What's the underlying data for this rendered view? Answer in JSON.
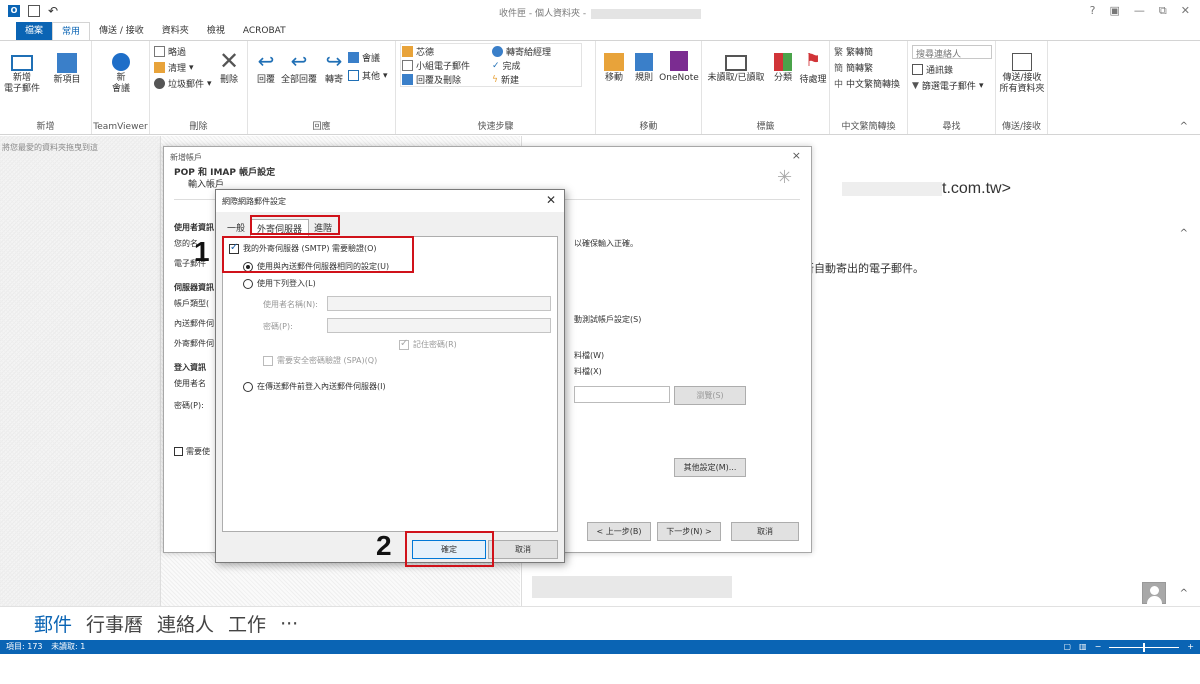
{
  "window": {
    "title_prefix": "收件匣 - 個人資料夾 - ",
    "controls": [
      "?",
      "▣",
      "—",
      "⧉",
      "✕"
    ]
  },
  "menu_tabs": [
    "檔案",
    "常用",
    "傳送 / 接收",
    "資料夾",
    "檢視",
    "ACROBAT"
  ],
  "ribbon": {
    "new_group": {
      "new_email": "新增\n電子郵件",
      "new_item": "新項目",
      "label": "新增"
    },
    "teamviewer": {
      "meeting": "新\n會議",
      "label": "TeamViewer"
    },
    "delete_group": {
      "ignore": "略過",
      "cleanup": "清理",
      "junk": "垃圾郵件",
      "delete": "刪除",
      "label": "刪除"
    },
    "respond_group": {
      "reply": "回覆",
      "reply_all": "全部回覆",
      "forward": "轉寄",
      "meeting": "會議",
      "more": "其他",
      "label": "回應"
    },
    "quicksteps_group": {
      "move_to": "芯德",
      "team_email": "小組電子郵件",
      "reply_delete": "回覆及刪除",
      "to_manager": "轉寄給經理",
      "done": "完成",
      "create_new": "新建",
      "label": "快速步驟"
    },
    "move_group": {
      "move": "移動",
      "rules": "規則",
      "onenote": "OneNote",
      "label": "移動"
    },
    "tags_group": {
      "unread_read": "未讀取/已讀取",
      "categorize": "分類",
      "follow_up": "待處理",
      "label": "標籤"
    },
    "chinese_group": {
      "to_traditional": "繁轉簡",
      "to_simplified": "簡轉繁",
      "conversion": "中文繁簡轉換",
      "label": "中文繁簡轉換"
    },
    "find_group": {
      "search_people": "搜尋連絡人",
      "address_book": "通訊錄",
      "filter_email": "篩選電子郵件",
      "label": "尋找"
    },
    "sendreceive_group": {
      "send_receive_all": "傳送/接收\n所有資料夾",
      "label": "傳送/接收"
    }
  },
  "left_pane": {
    "hint": "將您最愛的資料夾拖曳到這"
  },
  "reading_pane": {
    "email_suffix": "t.com.tw>",
    "auto_text": "是所自動寄出的電子郵件。"
  },
  "wizard": {
    "title": "新增帳戶",
    "heading": "POP 和 IMAP 帳戶設定",
    "subheading": "輸入帳戶",
    "user_info": "使用者資訊",
    "your_name": "您的名",
    "email": "電子郵件",
    "server_info": "伺服器資訊",
    "account_type": "帳戶類型(",
    "incoming": "內送郵件伺",
    "outgoing": "外寄郵件伺",
    "login_info": "登入資訊",
    "username": "使用者名",
    "password": "密碼(P):",
    "require": "需要使",
    "right_note": "以確保輸入正確。",
    "auto_test": "動測試帳戶設定(S)",
    "data_file_w": "料檔(W)",
    "data_file_x": "料檔(X)",
    "browse": "瀏覽(S)",
    "more_settings": "其他設定(M)...",
    "back": "< 上一步(B)",
    "next": "下一步(N) >",
    "cancel": "取消"
  },
  "settings_dialog": {
    "title": "網際網路郵件設定",
    "tabs": [
      "一般",
      "外寄伺服器",
      "進階"
    ],
    "smtp_auth": "我的外寄伺服器 (SMTP) 需要驗證(O)",
    "same_as_incoming": "使用與內送郵件伺服器相同的設定(U)",
    "login_with": "使用下列登入(L)",
    "username_label": "使用者名稱(N):",
    "password_label": "密碼(P):",
    "remember_password": "記住密碼(R)",
    "spa": "需要安全密碼驗證 (SPA)(Q)",
    "login_before_send": "在傳送郵件前登入內送郵件伺服器(I)",
    "ok": "確定",
    "cancel": "取消"
  },
  "annotations": {
    "step1": "1",
    "step2": "2"
  },
  "navigation": {
    "mail": "郵件",
    "calendar": "行事曆",
    "contacts": "連絡人",
    "tasks": "工作",
    "more": "···"
  },
  "statusbar": {
    "items": "項目: 173",
    "unread": "未讀取: 1"
  },
  "colors": {
    "accent": "#0a64b4",
    "highlight": "#d0121a"
  }
}
